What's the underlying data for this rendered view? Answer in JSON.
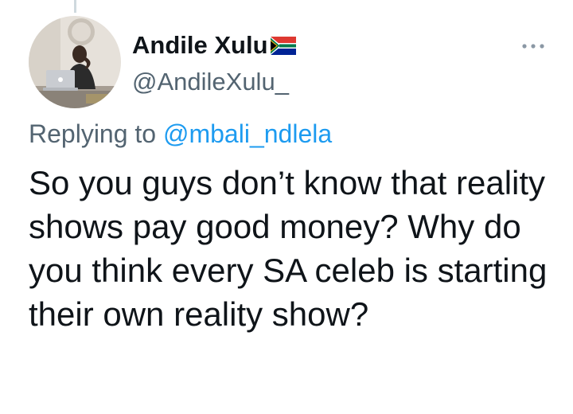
{
  "tweet": {
    "author": {
      "display_name": "Andile Xulu",
      "handle": "@AndileXulu_",
      "flag_icon": "south-africa-flag-icon",
      "avatar_icon": "profile-photo"
    },
    "more_icon": "more-dots-icon",
    "reply_prefix": "Replying to",
    "reply_to": "@mbali_ndlela",
    "text": "So you guys don’t know that reality shows pay good money? Why do you think every SA celeb is starting their own reality show?"
  },
  "colors": {
    "text": "#0f1419",
    "secondary": "#536471",
    "link": "#1d9bf0",
    "thread_line": "#cfd9de"
  }
}
